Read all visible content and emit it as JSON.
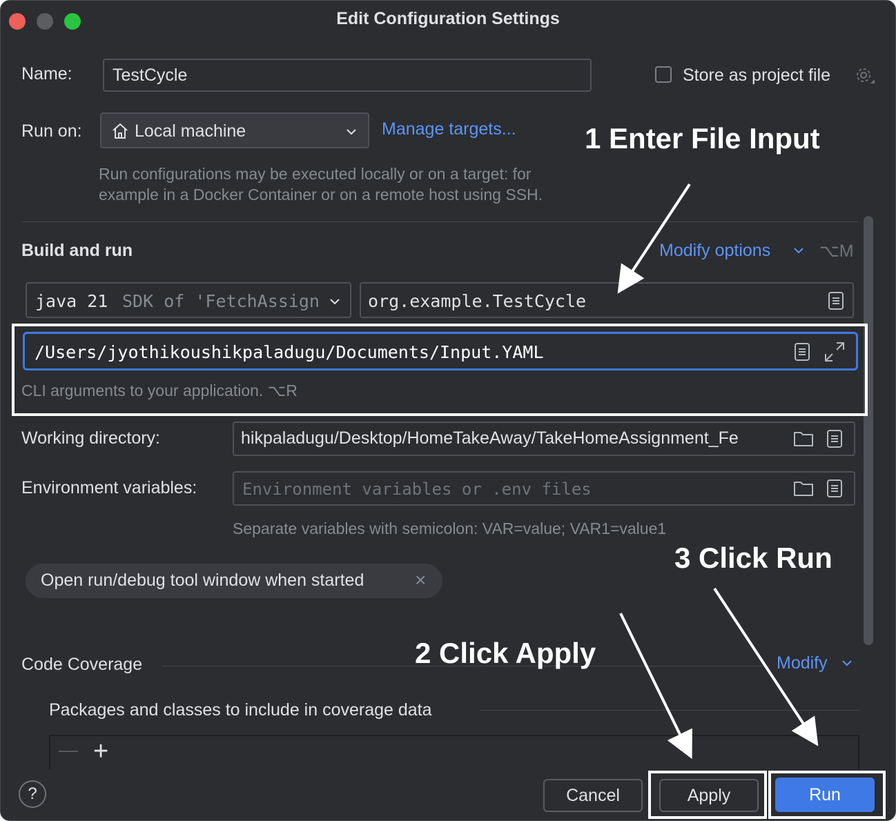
{
  "window": {
    "title": "Edit Configuration Settings"
  },
  "name_row": {
    "label": "Name:",
    "value": "TestCycle",
    "store_label": "Store as project file"
  },
  "run_on": {
    "label": "Run on:",
    "value": "Local machine",
    "manage_link": "Manage targets...",
    "hint_line1": "Run configurations may be executed locally or on a target: for",
    "hint_line2": "example in a Docker Container or on a remote host using SSH."
  },
  "build": {
    "heading": "Build and run",
    "modify_options": "Modify options",
    "modify_shortcut": "⌥M",
    "sdk_java": "java 21",
    "sdk_rest": "SDK of 'FetchAssign",
    "main_class": "org.example.TestCycle",
    "program_args": "/Users/jyothikoushikpaladugu/Documents/Input.YAML",
    "args_hint": "CLI arguments to your application. ⌥R"
  },
  "working_dir": {
    "label": "Working directory:",
    "value": "hikpaladugu/Desktop/HomeTakeAway/TakeHomeAssignment_Fe"
  },
  "env": {
    "label": "Environment variables:",
    "placeholder": "Environment variables or .env files",
    "hint": "Separate variables with semicolon: VAR=value; VAR1=value1"
  },
  "chip": {
    "label": "Open run/debug tool window when started",
    "close": "×"
  },
  "coverage": {
    "heading": "Code Coverage",
    "modify": "Modify",
    "packages_label": "Packages and classes to include in coverage data",
    "remove_icon": "—",
    "add_icon": "+"
  },
  "footer": {
    "help": "?",
    "cancel": "Cancel",
    "apply": "Apply",
    "run": "Run"
  },
  "annotations": {
    "step1": "1 Enter File Input",
    "step2": "2 Click Apply",
    "step3": "3 Click Run"
  },
  "colors": {
    "accent": "#3f79e6",
    "link": "#5c94f5",
    "background": "#2b2d30"
  }
}
